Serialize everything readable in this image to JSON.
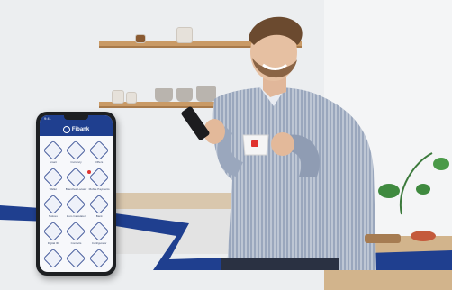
{
  "app": {
    "status_time": "9:41",
    "brand": "Fibank",
    "tiles": [
      {
        "label": "Smart",
        "icon": "grid-icon"
      },
      {
        "label": "Currency",
        "icon": "exchange-icon"
      },
      {
        "label": "Offers",
        "icon": "tag-icon"
      },
      {
        "label": "Wallet",
        "icon": "wallet-icon"
      },
      {
        "label": "Branches Locator",
        "icon": "pin-icon"
      },
      {
        "label": "Mobile Payments",
        "icon": "card-icon"
      },
      {
        "label": "Notices",
        "icon": "bell-icon"
      },
      {
        "label": "Euro Calculator",
        "icon": "euro-icon"
      },
      {
        "label": "Bank",
        "icon": "bank-icon"
      },
      {
        "label": "Digital ID",
        "icon": "id-icon"
      },
      {
        "label": "Contacts",
        "icon": "phone-icon"
      },
      {
        "label": "Configurator",
        "icon": "gear-icon"
      },
      {
        "label": "",
        "icon": "help-icon"
      },
      {
        "label": "",
        "icon": "info-icon"
      },
      {
        "label": "",
        "icon": "settings-icon"
      }
    ]
  },
  "colors": {
    "brand_blue": "#1f3f8f",
    "badge_red": "#e0322e"
  }
}
